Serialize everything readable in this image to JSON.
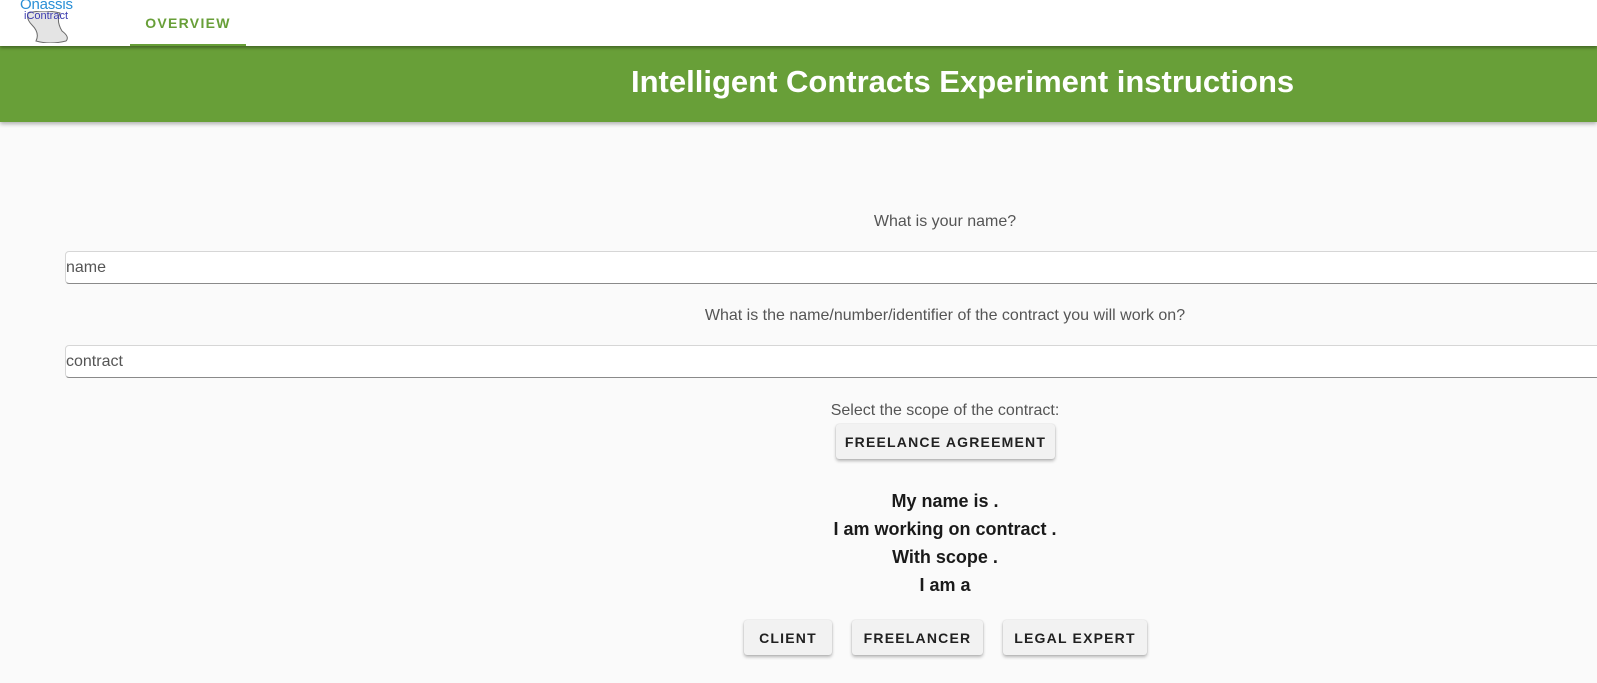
{
  "app": {
    "logo_line1": "Onassis",
    "logo_line2": "iContract"
  },
  "nav": {
    "tabs": [
      {
        "label": "OVERVIEW",
        "active": true
      }
    ]
  },
  "header": {
    "title": "Intelligent Contracts Experiment instructions",
    "color": "#689f38"
  },
  "form": {
    "name_question": "What is your name?",
    "name_placeholder": "name",
    "contract_question": "What is the name/number/identifier of the contract you will work on?",
    "contract_placeholder": "contract",
    "scope_question": "Select the scope of the contract:",
    "scope_button": "FREELANCE AGREEMENT"
  },
  "summary": {
    "line1": "My name is .",
    "line2": "I am working on contract .",
    "line3": "With scope .",
    "line4": "I am a"
  },
  "roles": {
    "client": "CLIENT",
    "freelancer": "FREELANCER",
    "legal_expert": "LEGAL EXPERT"
  },
  "icons": [
    "app-logo-icon"
  ]
}
